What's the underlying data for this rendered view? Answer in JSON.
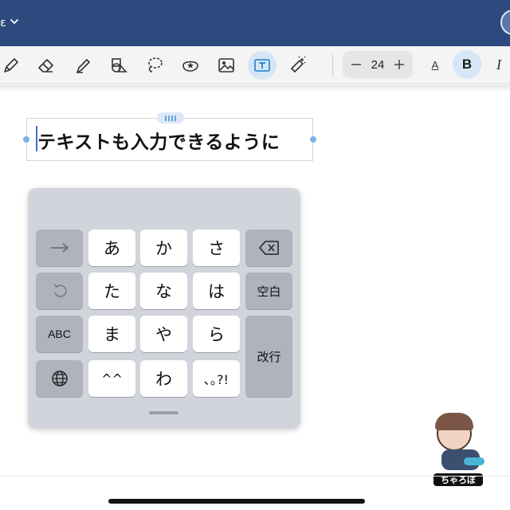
{
  "titlebar": {
    "crumb_text": "ε"
  },
  "toolbar": {
    "tools": [
      {
        "id": "pen",
        "icon": "pen-icon"
      },
      {
        "id": "eraser",
        "icon": "eraser-icon"
      },
      {
        "id": "highlighter",
        "icon": "highlighter-icon"
      },
      {
        "id": "shapes",
        "icon": "shapes-icon"
      },
      {
        "id": "lasso",
        "icon": "lasso-icon"
      },
      {
        "id": "sticker",
        "icon": "sticker-icon"
      },
      {
        "id": "image",
        "icon": "image-icon"
      },
      {
        "id": "text",
        "icon": "text-box-icon",
        "active": true
      },
      {
        "id": "laser",
        "icon": "laser-pointer-icon"
      }
    ],
    "font_size": "24",
    "underline_label": "A",
    "bold_label": "B",
    "italic_label": "I",
    "accent_color": "#3b6fd8"
  },
  "canvas": {
    "text_box": {
      "text": "テキストも入力できるように"
    }
  },
  "keyboard": {
    "keys": {
      "arrow": "→",
      "a": "あ",
      "ka": "か",
      "sa": "さ",
      "ta": "た",
      "na": "な",
      "ha": "は",
      "abc": "ABC",
      "ma": "ま",
      "ya": "や",
      "ra": "ら",
      "kaomoji": "^^",
      "wa": "わ",
      "punct": "､｡?!",
      "space": "空白",
      "enter": "改行"
    }
  },
  "sticker": {
    "tag": "ちゃろぼ"
  }
}
